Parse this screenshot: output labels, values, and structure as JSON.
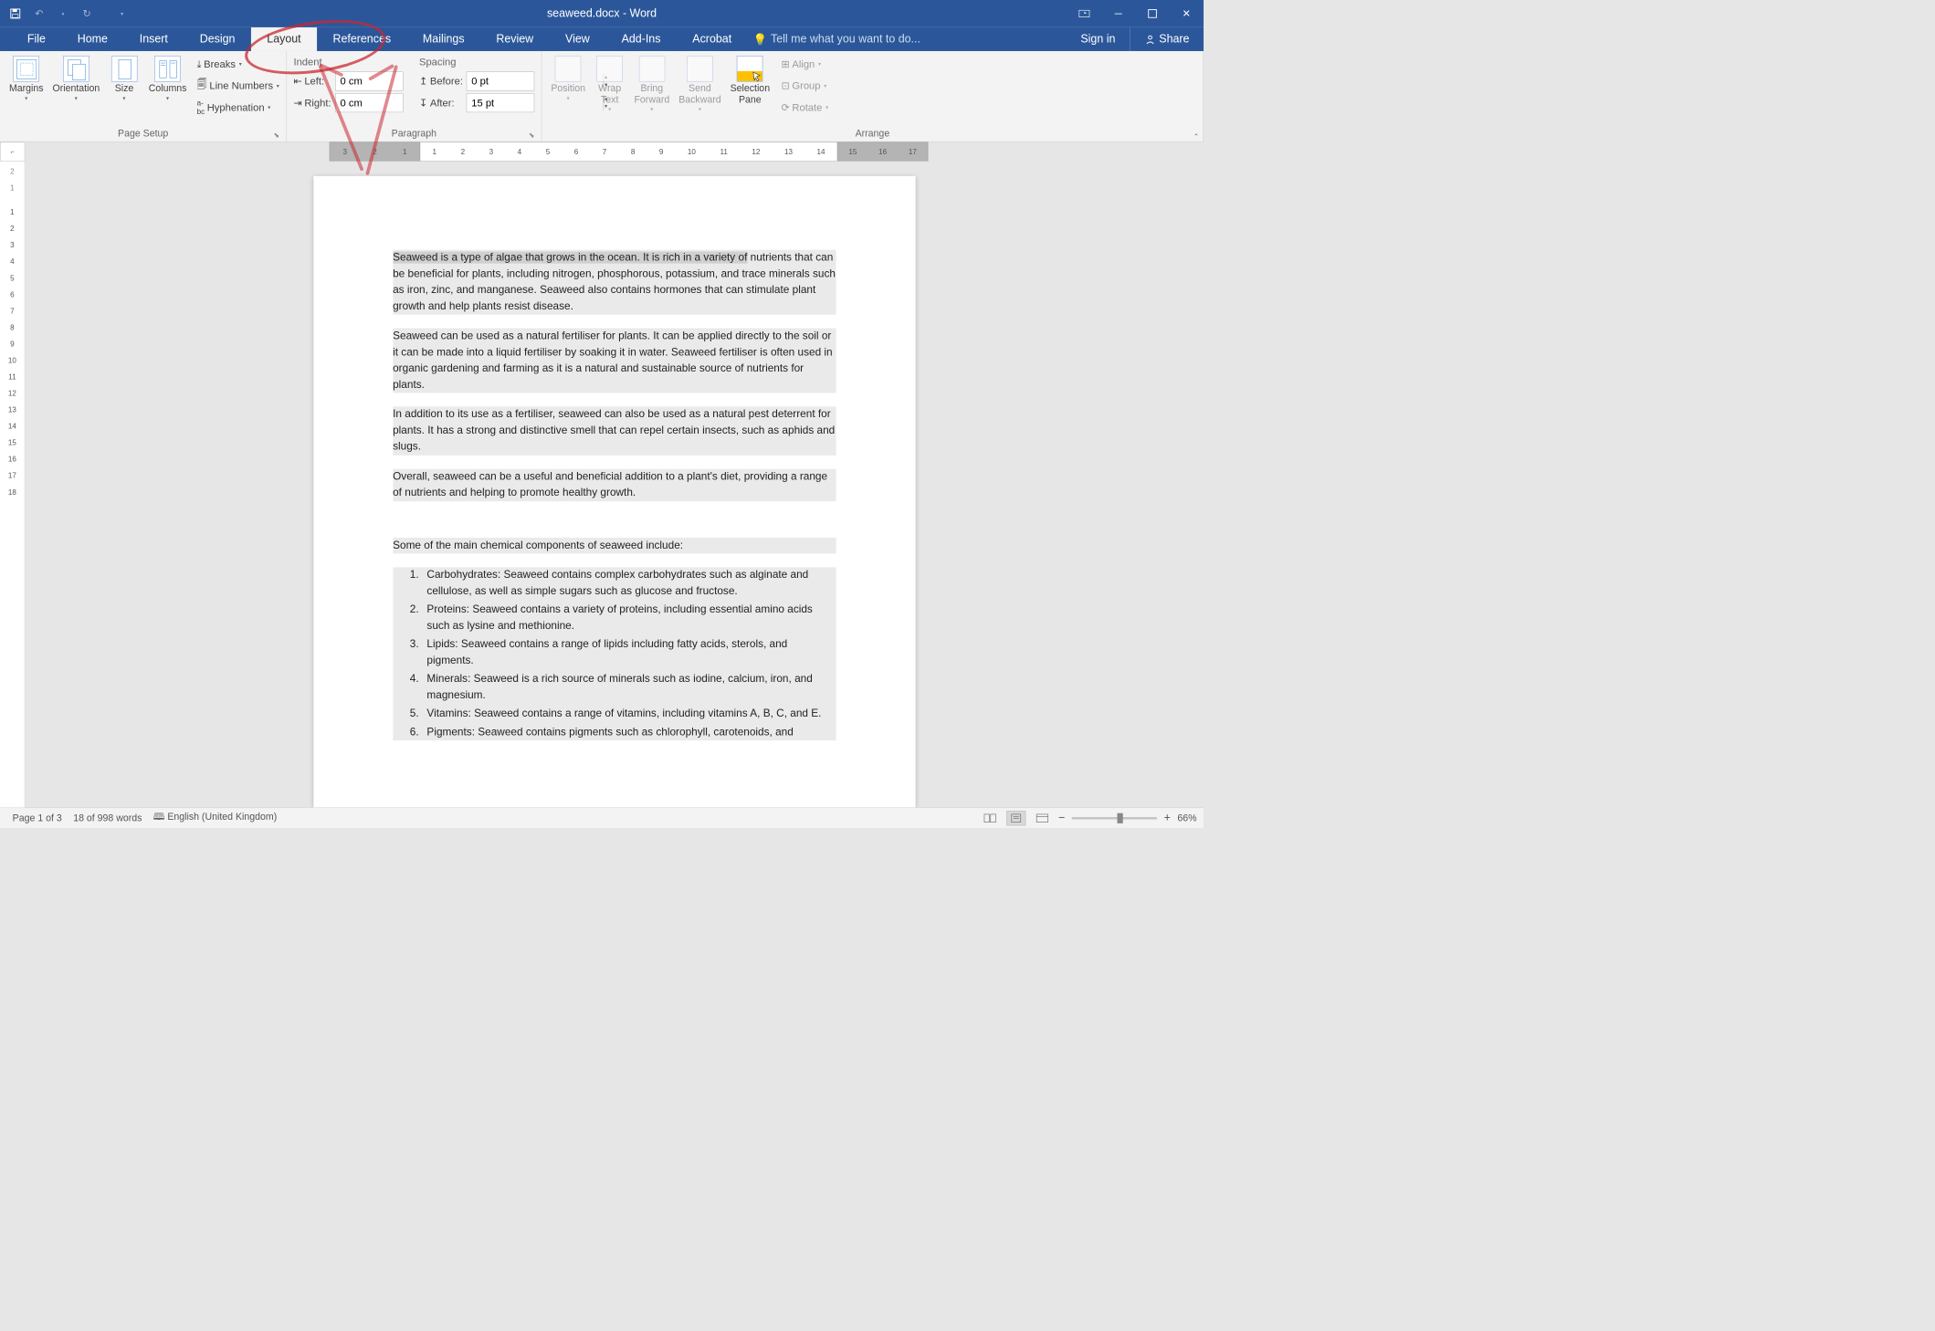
{
  "title": "seaweed.docx - Word",
  "tabs": [
    "File",
    "Home",
    "Insert",
    "Design",
    "Layout",
    "References",
    "Mailings",
    "Review",
    "View",
    "Add-Ins",
    "Acrobat"
  ],
  "active_tab": "Layout",
  "tellme": "Tell me what you want to do...",
  "signin": "Sign in",
  "share": "Share",
  "ribbon": {
    "page_setup": {
      "label": "Page Setup",
      "margins": "Margins",
      "orientation": "Orientation",
      "size": "Size",
      "columns": "Columns",
      "breaks": "Breaks",
      "line_numbers": "Line Numbers",
      "hyphenation": "Hyphenation"
    },
    "paragraph": {
      "label": "Paragraph",
      "indent_header": "Indent",
      "spacing_header": "Spacing",
      "left_label": "Left:",
      "right_label": "Right:",
      "before_label": "Before:",
      "after_label": "After:",
      "left_val": "0 cm",
      "right_val": "0 cm",
      "before_val": "0 pt",
      "after_val": "15 pt"
    },
    "arrange": {
      "label": "Arrange",
      "position": "Position",
      "wrap": "Wrap\nText",
      "bring": "Bring\nForward",
      "send": "Send\nBackward",
      "selection": "Selection\nPane",
      "align": "Align",
      "group": "Group",
      "rotate": "Rotate"
    }
  },
  "hruler_left": [
    "3",
    "2",
    "1"
  ],
  "hruler_main": [
    "1",
    "2",
    "3",
    "4",
    "5",
    "6",
    "7",
    "8",
    "9",
    "10",
    "11",
    "12",
    "13",
    "14"
  ],
  "hruler_right": [
    "15",
    "16",
    "17"
  ],
  "vruler": [
    "2",
    "1",
    "",
    "1",
    "2",
    "3",
    "4",
    "5",
    "6",
    "7",
    "8",
    "9",
    "10",
    "11",
    "12",
    "13",
    "14",
    "15",
    "16",
    "17",
    "18"
  ],
  "doc": {
    "p1_hl": "Seaweed is a type of algae that grows in the ocean. It is rich in a variety of",
    "p1_rest": " nutrients that can be beneficial for plants, including nitrogen, phosphorous, potassium, and trace minerals such as iron, zinc, and manganese. Seaweed also contains hormones that can stimulate plant growth and help plants resist disease.",
    "p2": "Seaweed can be used as a natural fertiliser for plants. It can be applied directly to the soil or it can be made into a liquid fertiliser by soaking it in water. Seaweed fertiliser is often used in organic gardening and farming as it is a natural and sustainable source of nutrients for plants.",
    "p3": "In addition to its use as a fertiliser, seaweed can also be used as a natural pest deterrent for plants. It has a strong and distinctive smell that can repel certain insects, such as aphids and slugs.",
    "p4": "Overall, seaweed can be a useful and beneficial addition to a plant's diet, providing a range of nutrients and helping to promote healthy growth.",
    "heading": "Some of the main chemical components of seaweed include:",
    "items": [
      "Carbohydrates: Seaweed contains complex carbohydrates such as alginate and cellulose, as well as simple sugars such as glucose and fructose.",
      "Proteins: Seaweed contains a variety of proteins, including essential amino acids such as lysine and methionine.",
      "Lipids: Seaweed contains a range of lipids including fatty acids, sterols, and pigments.",
      "Minerals: Seaweed is a rich source of minerals such as iodine, calcium, iron, and magnesium.",
      "Vitamins: Seaweed contains a range of vitamins, including vitamins A, B, C, and E.",
      "Pigments: Seaweed contains pigments such as chlorophyll, carotenoids, and"
    ]
  },
  "status": {
    "page": "Page 1 of 3",
    "words": "18 of 998 words",
    "lang": "English (United Kingdom)",
    "zoom": "66%"
  }
}
